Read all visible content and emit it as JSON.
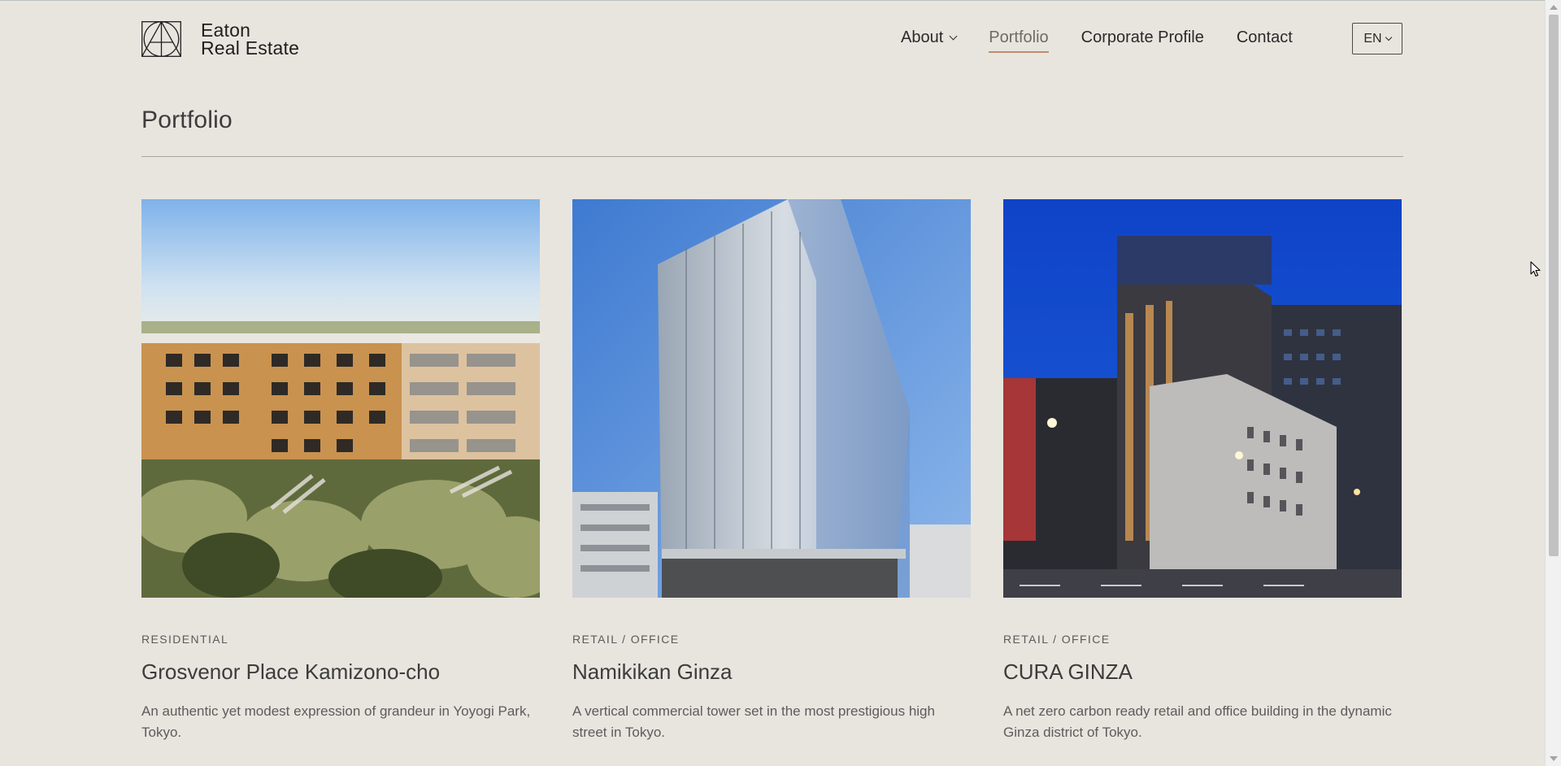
{
  "brand": {
    "line1": "Eaton",
    "line2": "Real Estate"
  },
  "nav": {
    "items": [
      {
        "label": "About",
        "dropdown": true
      },
      {
        "label": "Portfolio",
        "active": true
      },
      {
        "label": "Corporate Profile"
      },
      {
        "label": "Contact"
      }
    ],
    "language": "EN"
  },
  "page": {
    "title": "Portfolio"
  },
  "cards": [
    {
      "category": "RESIDENTIAL",
      "title": "Grosvenor Place Kamizono-cho",
      "description": "An authentic yet modest expression of grandeur in Yoyogi Park, Tokyo."
    },
    {
      "category": "RETAIL / OFFICE",
      "title": "Namikikan Ginza",
      "description": "A vertical commercial tower set in the most prestigious high street in Tokyo."
    },
    {
      "category": "RETAIL / OFFICE",
      "title": "CURA GINZA",
      "description": "A net zero carbon ready retail and office building in the dynamic Ginza district of Tokyo."
    }
  ],
  "colors": {
    "background": "#e8e5df",
    "active_underline": "#c08b6a",
    "text": "#3b3b3b"
  }
}
